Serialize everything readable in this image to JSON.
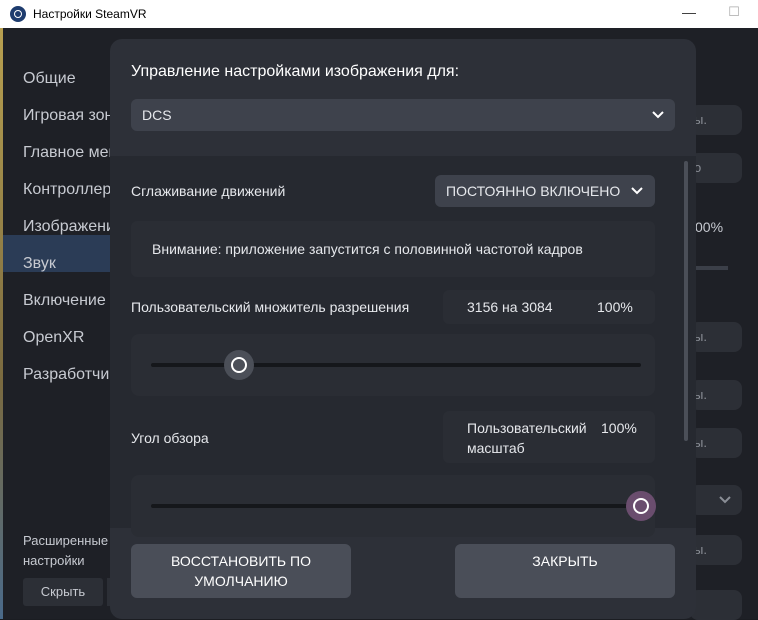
{
  "window": {
    "title": "Настройки SteamVR",
    "minimize_glyph": "—",
    "maximize_glyph": "☐"
  },
  "sidebar": {
    "items": [
      {
        "label": "Общие"
      },
      {
        "label": "Игровая зона"
      },
      {
        "label": "Главное меню"
      },
      {
        "label": "Контроллеры"
      },
      {
        "label": "Изображение"
      },
      {
        "label": "Звук"
      },
      {
        "label": "Включение"
      },
      {
        "label": "OpenXR"
      },
      {
        "label": "Разработчик"
      }
    ],
    "advanced_label": "Расширенные настройки",
    "hide_button": "Скрыть"
  },
  "background": {
    "pill_1": "ы.",
    "pill_2": "о",
    "percent": "00%",
    "pill_3": "ы.",
    "pill_4": "ы.",
    "pill_5": "ы.",
    "pill_6": "ы."
  },
  "dialog": {
    "title": "Управление настройками изображения для:",
    "app_select_value": "DCS",
    "motion_smoothing_label": "Сглаживание движений",
    "motion_smoothing_value": "ПОСТОЯННО ВКЛЮЧЕНО",
    "warning": "Внимание: приложение запустится с половинной частотой кадров",
    "resolution_label": "Пользовательский множитель разрешения",
    "resolution_value": "3156 на 3084",
    "resolution_percent": "100%",
    "resolution_slider_level": 0.18,
    "fov_label": "Угол обзора",
    "fov_value_line1": "Пользовательский",
    "fov_value_line2": "масштаб",
    "fov_percent": "100%",
    "fov_slider_level": 1.0,
    "reset_button_line1": "ВОССТАНОВИТЬ ПО",
    "reset_button_line2": "УМОЛЧАНИЮ",
    "close_button": "ЗАКРЫТЬ"
  },
  "colors": {
    "dialog_bg": "#2d3038",
    "accent_knob": "#6a4d6e",
    "button_bg": "#4a4e58"
  }
}
